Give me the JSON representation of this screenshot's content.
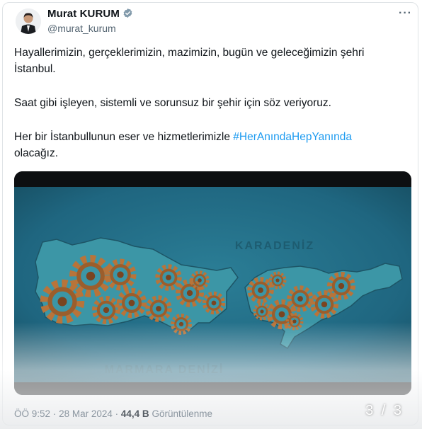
{
  "author": {
    "name": "Murat KURUM",
    "handle": "@murat_kurum",
    "verified_color": "#829aab"
  },
  "tweet": {
    "paragraph_1": "Hayallerimizin, gerçeklerimizin, mazimizin, bugün ve geleceğimizin şehri İstanbul.",
    "paragraph_2": "Saat gibi işleyen, sistemli ve sorunsuz bir şehir için söz veriyoruz.",
    "paragraph_3_prefix": "Her bir İstanbullunun eser ve hizmetlerimizle ",
    "hashtag": "#HerAnındaHepYanında",
    "paragraph_3_suffix": "olacağız."
  },
  "media": {
    "map_label_north": "KARADENİZ",
    "map_label_south": "MARMARA DENİZİ",
    "colors": {
      "sea": "#226e86",
      "land": "#3c96a6",
      "gear": "#b8743a"
    }
  },
  "footer": {
    "time": "ÖÖ 9:52",
    "separator": "·",
    "date": "28 Mar 2024",
    "views_count": "44,4 B",
    "views_label": "Görüntülenme",
    "image_counter": "3 / 3"
  },
  "icons": {
    "more": "more-dots-icon",
    "verified": "verified-badge-icon"
  },
  "accent": "#1d9bf0"
}
